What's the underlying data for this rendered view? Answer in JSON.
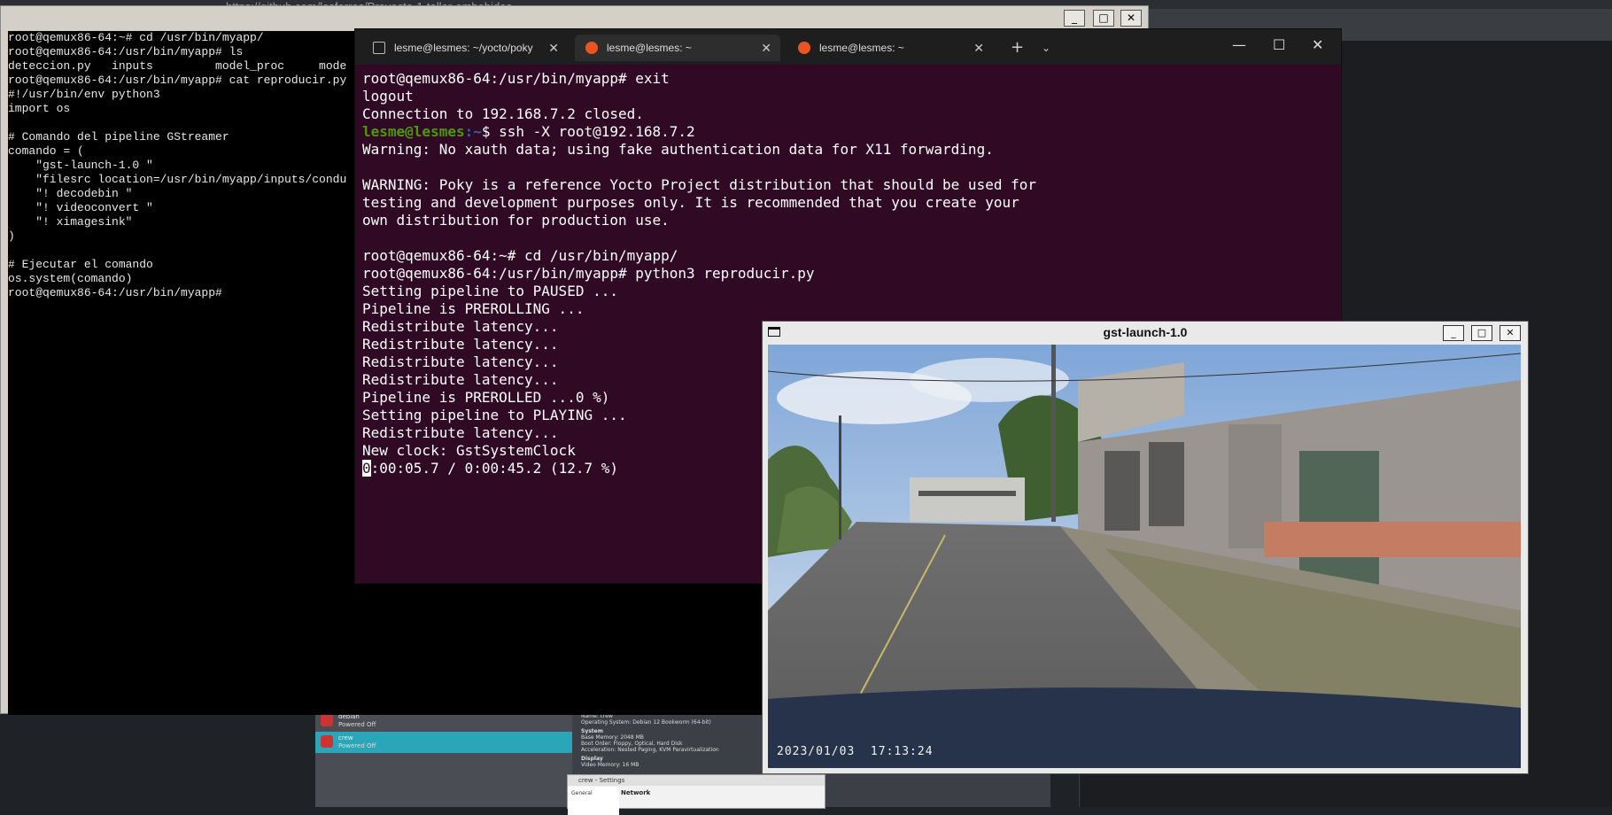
{
  "background": {
    "browser_url": "https://github.com/lesforres/Proyecto-1-taller-embebidos",
    "vbox": {
      "vms": [
        {
          "name": "debian",
          "state": "Powered Off",
          "selected": false
        },
        {
          "name": "crew",
          "state": "Powered Off",
          "selected": true
        }
      ],
      "details": [
        "Name:  crew",
        "Operating System:  Debian 12 Bookworm (64-bit)",
        "System",
        "Base Memory:  2048 MB",
        "Boot Order:  Floppy, Optical, Hard Disk",
        "Acceleration:  Nested Paging, KVM Paravirtualization",
        "Display",
        "Video Memory:  16 MB"
      ],
      "settings_title": "crew - Settings",
      "settings_side": "General",
      "settings_section": "Network"
    }
  },
  "qemu": {
    "controls": {
      "minimize": "_",
      "maximize": "□",
      "close": "✕"
    },
    "lines": [
      "root@qemux86-64:~# cd /usr/bin/myapp/",
      "root@qemux86-64:/usr/bin/myapp# ls",
      "deteccion.py   inputs         model_proc     mode",
      "root@qemux86-64:/usr/bin/myapp# cat reproducir.py",
      "#!/usr/bin/env python3",
      "import os",
      "",
      "# Comando del pipeline GStreamer",
      "comando = (",
      "    \"gst-launch-1.0 \"",
      "    \"filesrc location=/usr/bin/myapp/inputs/condu",
      "    \"! decodebin \"",
      "    \"! videoconvert \"",
      "    \"! ximagesink\"",
      ")",
      "",
      "# Ejecutar el comando",
      "os.system(comando)",
      "root@qemux86-64:/usr/bin/myapp#"
    ]
  },
  "terminal": {
    "tabs": [
      {
        "label": "lesme@lesmes: ~/yocto/poky",
        "icon": "terminal-icon",
        "active": false
      },
      {
        "label": "lesme@lesmes: ~",
        "icon": "ubuntu-icon",
        "active": true
      },
      {
        "label": "lesme@lesmes: ~",
        "icon": "ubuntu-icon",
        "active": false
      }
    ],
    "new_tab": "+",
    "dropdown": "⌄",
    "controls": {
      "minimize": "—",
      "maximize": "☐",
      "close": "✕"
    },
    "lines": [
      "root@qemux86-64:/usr/bin/myapp# exit",
      "logout",
      "Connection to 192.168.7.2 closed.",
      "",
      "Warning: No xauth data; using fake authentication data for X11 forwarding.",
      "",
      "WARNING: Poky is a reference Yocto Project distribution that should be used for",
      "testing and development purposes only. It is recommended that you create your",
      "own distribution for production use.",
      "",
      "root@qemux86-64:~# cd /usr/bin/myapp/",
      "root@qemux86-64:/usr/bin/myapp# python3 reproducir.py",
      "Setting pipeline to PAUSED ...",
      "Pipeline is PREROLLING ...",
      "Redistribute latency...",
      "Redistribute latency...",
      "Redistribute latency...",
      "Redistribute latency...",
      "Pipeline is PREROLLED ...0 %)",
      "Setting pipeline to PLAYING ...",
      "Redistribute latency...",
      "New clock: GstSystemClock"
    ],
    "prompt_user": "lesme@lesmes",
    "prompt_path": ":~",
    "prompt_cmd": "$ ssh -X root@192.168.7.2",
    "progress_cursor": "0",
    "progress_rest": ":00:05.7 / 0:00:45.2 (12.7 %)"
  },
  "gst": {
    "title": "gst-launch-1.0",
    "controls": {
      "minimize": "_",
      "maximize": "□",
      "close": "✕"
    },
    "timestamp": "2023/01/03  17:13:24"
  }
}
